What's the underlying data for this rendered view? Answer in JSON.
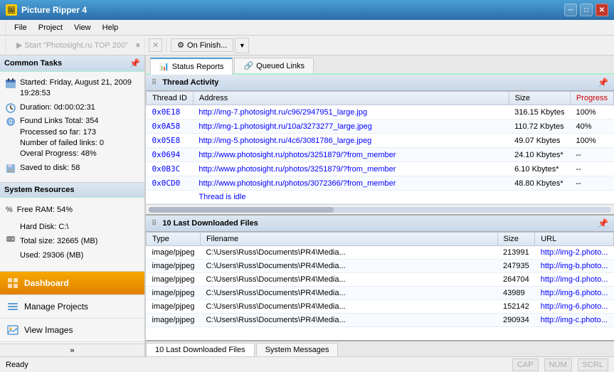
{
  "titleBar": {
    "title": "Picture Ripper 4",
    "minBtn": "─",
    "maxBtn": "□",
    "closeBtn": "✕"
  },
  "menu": {
    "items": [
      "File",
      "Project",
      "View",
      "Help"
    ]
  },
  "toolbar": {
    "startBtn": "Start \"Photosight.ru TOP 200\"",
    "pauseIcon": "⏸",
    "stopIcon": "✕",
    "onFinishBtn": "On Finish..."
  },
  "leftPanel": {
    "commonTasksHeader": "Common Tasks",
    "pinSymbol": "📌",
    "tasks": [
      {
        "icon": "calendar",
        "text": "Started: Friday, August 21, 2009 19:28:53"
      },
      {
        "icon": "clock",
        "text": "Duration: 0d:00:02:31"
      },
      {
        "icon": "link",
        "text": "Found Links Total: 354\nProcessed so far: 173\nNumber of failed links: 0\nOveral Progress: 48%"
      },
      {
        "icon": "disk",
        "text": "Saved to disk: 58"
      }
    ],
    "sysResourcesHeader": "System Resources",
    "sysResources": [
      {
        "icon": "percent",
        "text": "Free RAM: 54%"
      },
      {
        "icon": "harddisk",
        "text": "Hard Disk: C:\\\nTotal size: 32665 (MB)\nUsed: 29306 (MB)"
      }
    ],
    "navItems": [
      {
        "id": "dashboard",
        "label": "Dashboard",
        "active": true
      },
      {
        "id": "manage-projects",
        "label": "Manage Projects",
        "active": false
      },
      {
        "id": "view-images",
        "label": "View Images",
        "active": false
      }
    ]
  },
  "rightPanel": {
    "tabs": [
      {
        "id": "status-reports",
        "label": "Status Reports",
        "active": true
      },
      {
        "id": "queued-links",
        "label": "Queued Links",
        "active": false
      }
    ],
    "threadActivity": {
      "sectionTitle": "Thread Activity",
      "columns": [
        "Thread ID",
        "Address",
        "Size",
        "Progress"
      ],
      "rows": [
        {
          "threadId": "0x0E18",
          "address": "http://img-7.photosight.ru/c96/2947951_large.jpg",
          "size": "316.15 Kbytes",
          "progress": "100%"
        },
        {
          "threadId": "0x0A58",
          "address": "http://img-1.photosight.ru/10a/3273277_large.jpeg",
          "size": "110.72 Kbytes",
          "progress": "40%"
        },
        {
          "threadId": "0x05E8",
          "address": "http://img-5.photosight.ru/4c6/3081786_large.jpeg",
          "size": "49.07 Kbytes",
          "progress": "100%"
        },
        {
          "threadId": "0x0694",
          "address": "http://www.photosight.ru/photos/3251879/?from_member",
          "size": "24.10 Kbytes*",
          "progress": "--"
        },
        {
          "threadId": "0x0B3C",
          "address": "http://www.photosight.ru/photos/3251879/?from_member",
          "size": "6.10 Kbytes*",
          "progress": "--"
        },
        {
          "threadId": "0x0CD0",
          "address": "http://www.photosight.ru/photos/3072366/?from_member",
          "size": "48.80 Kbytes*",
          "progress": "--"
        },
        {
          "threadId": "",
          "address": "Thread is idle",
          "size": "",
          "progress": ""
        }
      ]
    },
    "downloadedFiles": {
      "sectionTitle": "10 Last Downloaded Files",
      "columns": [
        "Type",
        "Filename",
        "Size",
        "URL"
      ],
      "rows": [
        {
          "type": "image/pjpeg",
          "filename": "C:\\Users\\Russ\\Documents\\PR4\\Media...",
          "size": "213991",
          "url": "http://img-2.photo..."
        },
        {
          "type": "image/pjpeg",
          "filename": "C:\\Users\\Russ\\Documents\\PR4\\Media...",
          "size": "247935",
          "url": "http://img-b.photo..."
        },
        {
          "type": "image/pjpeg",
          "filename": "C:\\Users\\Russ\\Documents\\PR4\\Media...",
          "size": "264704",
          "url": "http://img-d.photo..."
        },
        {
          "type": "image/pjpeg",
          "filename": "C:\\Users\\Russ\\Documents\\PR4\\Media...",
          "size": "43989",
          "url": "http://img-6.photo..."
        },
        {
          "type": "image/pjpeg",
          "filename": "C:\\Users\\Russ\\Documents\\PR4\\Media...",
          "size": "152142",
          "url": "http://img-6.photo..."
        },
        {
          "type": "image/pjpeg",
          "filename": "C:\\Users\\Russ\\Documents\\PR4\\Media...",
          "size": "290934",
          "url": "http://img-c.photo..."
        }
      ]
    },
    "bottomTabs": [
      {
        "id": "last-downloaded",
        "label": "10 Last Downloaded Files",
        "active": true
      },
      {
        "id": "system-messages",
        "label": "System Messages",
        "active": false
      }
    ]
  },
  "statusBar": {
    "status": "Ready",
    "cap": "CAP",
    "num": "NUM",
    "scrl": "SCRL"
  }
}
